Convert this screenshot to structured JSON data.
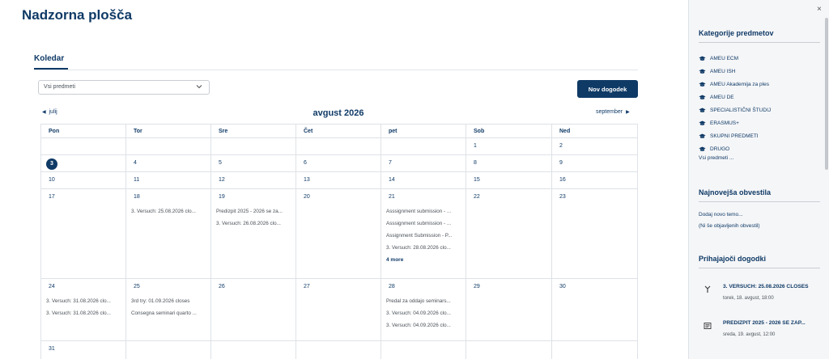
{
  "page": {
    "title": "Nadzorna plošča"
  },
  "calendar": {
    "section_title": "Koledar",
    "course_filter": "Vsi predmeti",
    "new_event_label": "Nov dogodek",
    "prev_month": "julij",
    "next_month": "september",
    "month_title": "avgust 2026",
    "weekdays": [
      "Pon",
      "Tor",
      "Sre",
      "Čet",
      "pet",
      "Sob",
      "Ned"
    ],
    "weeks": [
      [
        {
          "day": "",
          "events": []
        },
        {
          "day": "",
          "events": []
        },
        {
          "day": "",
          "events": []
        },
        {
          "day": "",
          "events": []
        },
        {
          "day": "",
          "events": []
        },
        {
          "day": "1",
          "events": []
        },
        {
          "day": "2",
          "events": []
        }
      ],
      [
        {
          "day": "3",
          "today": true,
          "events": []
        },
        {
          "day": "4",
          "events": []
        },
        {
          "day": "5",
          "events": []
        },
        {
          "day": "6",
          "events": []
        },
        {
          "day": "7",
          "events": []
        },
        {
          "day": "8",
          "events": []
        },
        {
          "day": "9",
          "events": []
        }
      ],
      [
        {
          "day": "10",
          "events": []
        },
        {
          "day": "11",
          "events": []
        },
        {
          "day": "12",
          "events": []
        },
        {
          "day": "13",
          "events": []
        },
        {
          "day": "14",
          "events": []
        },
        {
          "day": "15",
          "events": []
        },
        {
          "day": "16",
          "events": []
        }
      ],
      [
        {
          "day": "17",
          "events": []
        },
        {
          "day": "18",
          "events": [
            "3. Versuch: 25.08.2026 clo..."
          ]
        },
        {
          "day": "19",
          "events": [
            "Predizpit 2025 - 2026 se za...",
            "3. Versuch: 26.08.2026 clo..."
          ]
        },
        {
          "day": "20",
          "events": []
        },
        {
          "day": "21",
          "events": [
            "Asssignment submission - ...",
            "Asssignment submission - ...",
            "Assignment Submission - P...",
            "3. Versuch: 28.08.2026 clo..."
          ],
          "more": "4 more"
        },
        {
          "day": "22",
          "events": []
        },
        {
          "day": "23",
          "events": []
        }
      ],
      [
        {
          "day": "24",
          "events": [
            "3. Versuch: 31.08.2026 clo...",
            "3. Versuch: 31.08.2026 clo..."
          ]
        },
        {
          "day": "25",
          "events": [
            "3rd try: 01.09.2026 closes",
            "Consegna seminari quarto ..."
          ]
        },
        {
          "day": "26",
          "events": []
        },
        {
          "day": "27",
          "events": []
        },
        {
          "day": "28",
          "events": [
            "Predal za oddajo seminars...",
            "3. Versuch: 04.09.2026 clo...",
            "3. Versuch: 04.09.2026 clo..."
          ]
        },
        {
          "day": "29",
          "events": []
        },
        {
          "day": "30",
          "events": []
        }
      ],
      [
        {
          "day": "31",
          "events": []
        },
        {
          "day": "",
          "events": []
        },
        {
          "day": "",
          "events": []
        },
        {
          "day": "",
          "events": []
        },
        {
          "day": "",
          "events": []
        },
        {
          "day": "",
          "events": []
        },
        {
          "day": "",
          "events": []
        }
      ]
    ]
  },
  "drawer": {
    "close_icon": "×",
    "categories": {
      "title": "Kategorije predmetov",
      "items": [
        "AMEU ECM",
        "AMEU ISH",
        "AMEU Akademija za ples",
        "AMEU DE",
        "SPECIALISTIČNI ŠTUDIJ",
        "ERASMUS+",
        "SKUPNI PREDMETI",
        "DRUGO"
      ],
      "all_courses": "Vsi predmeti ..."
    },
    "news": {
      "title": "Najnovejša obvestila",
      "add_topic": "Dodaj novo temo...",
      "empty": "(Ni še objavljenih obvestil)"
    },
    "upcoming": {
      "title": "Prihajajoči dogodki",
      "items": [
        {
          "title": "3. VERSUCH: 25.08.2026 CLOSES",
          "date": "torek, 18. avgust, 18:00",
          "icon": "assignment-icon"
        },
        {
          "title": "PREDIZPIT 2025 - 2026 SE ZAP...",
          "date": "sreda, 19. avgust, 12:00",
          "icon": "quiz-icon"
        }
      ]
    }
  },
  "colors": {
    "accent": "#0f3a66",
    "drawer_bg": "#f5f6f8",
    "grid": "#dee2e6"
  }
}
